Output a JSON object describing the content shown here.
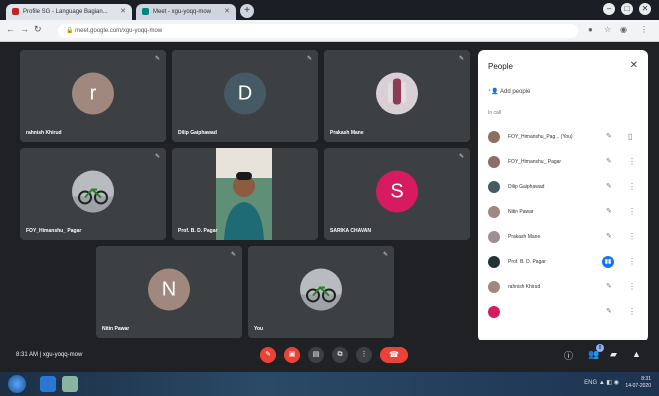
{
  "browser": {
    "tabs": [
      {
        "title": "Profile SG - Language Bagian..."
      },
      {
        "title": "Meet - xgu-yoqq-mow"
      }
    ],
    "url": "meet.google.com/xgu-yoqq-mow"
  },
  "tiles": [
    {
      "name": "rahnish Khirud",
      "initial": "r",
      "color": "#a1887f"
    },
    {
      "name": "Dilip Gaiphawad",
      "initial": "D",
      "color": "#455a64"
    },
    {
      "name": "Prakash Mane",
      "initial": "",
      "color": "#c9c2c6"
    },
    {
      "name": "FOY_Himanshu_ Pagar",
      "initial": "",
      "color": "#b8bbbf"
    },
    {
      "name": "Prof. B. D. Pagar",
      "initial": "",
      "color": "#4d7a63"
    },
    {
      "name": "SARIKA CHAVAN",
      "initial": "S",
      "color": "#d81b60"
    },
    {
      "name": "Nitin Pawar",
      "initial": "N",
      "color": "#a1887f"
    },
    {
      "name": "You",
      "initial": "",
      "color": "#b8bbbf"
    }
  ],
  "people_panel": {
    "title": "People",
    "add_people": "Add people",
    "in_call_label": "In call",
    "people": [
      {
        "name": "FOY_Himanshu_Pag... (You)",
        "color": "#8d6e63",
        "speaking": false
      },
      {
        "name": "FOY_Himanshu_ Pagar",
        "color": "#8d6e63",
        "speaking": false
      },
      {
        "name": "Dilip Gaiphawad",
        "color": "#455a64",
        "speaking": false
      },
      {
        "name": "Nitin Pawar",
        "color": "#a1887f",
        "speaking": false
      },
      {
        "name": "Prakash Mane",
        "color": "#9e8f94",
        "speaking": false
      },
      {
        "name": "Prof. B. D. Pagar",
        "color": "#263238",
        "speaking": true
      },
      {
        "name": "rahnish Khirud",
        "color": "#a1887f",
        "speaking": false
      }
    ]
  },
  "bottom_bar": {
    "time": "8:31 AM",
    "separator": "|",
    "meeting_code": "xgu-yoqq-mow",
    "participant_badge": "8"
  },
  "taskbar": {
    "tray": "ENG",
    "clock_time": "8:31",
    "clock_date": "14-07-2020"
  }
}
